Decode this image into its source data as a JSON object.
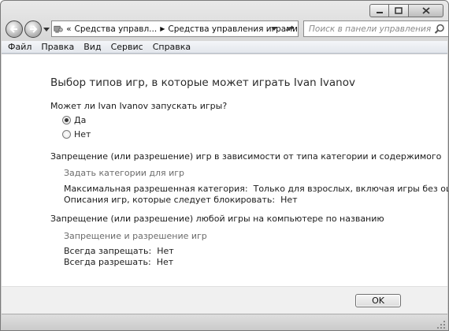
{
  "window": {
    "caption_buttons": [
      "minimize",
      "maximize",
      "close"
    ]
  },
  "nav": {
    "breadcrumbs": [
      "Средства управл...",
      "Средства управления играми"
    ],
    "overflow_glyph": "«",
    "search_placeholder": "Поиск в панели управления"
  },
  "menu": {
    "items": [
      "Файл",
      "Правка",
      "Вид",
      "Сервис",
      "Справка"
    ]
  },
  "main": {
    "title": "Выбор типов игр, в которые может играть Ivan Ivanov",
    "question": "Может ли Ivan Ivanov запускать игры?",
    "options": [
      {
        "label": "Да",
        "checked": true
      },
      {
        "label": "Нет",
        "checked": false
      }
    ],
    "section1": {
      "heading": "Запрещение (или разрешение) игр в зависимости от типа категории и содержимого",
      "link": "Задать категории для игр",
      "max_category_label": "Максимальная разрешенная категория:",
      "max_category_value": "Только для взрослых, включая игры без оценки",
      "block_desc_label": "Описания игр, которые следует блокировать:",
      "block_desc_value": "Нет"
    },
    "section2": {
      "heading": "Запрещение (или разрешение) любой игры на компьютере по названию",
      "link": "Запрещение и разрешение игр",
      "always_block_label": "Всегда запрещать:",
      "always_block_value": "Нет",
      "always_allow_label": "Всегда разрешать:",
      "always_allow_value": "Нет"
    }
  },
  "footer": {
    "ok_label": "OK"
  },
  "colors": {
    "link": "#6b6b6b",
    "content_bg": "#ffffff",
    "chrome_bg": "#d4d4d4"
  }
}
